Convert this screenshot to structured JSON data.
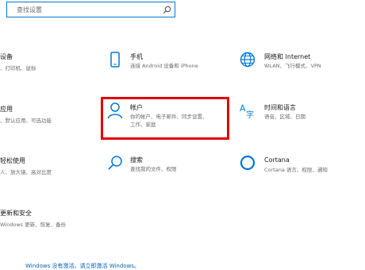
{
  "search": {
    "placeholder": "查找设置"
  },
  "left_column": [
    {
      "title": "设备",
      "desc": "、打印机、鼠标"
    },
    {
      "title": "应用",
      "desc": "、默认应用、可选功能"
    },
    {
      "title": "轻松使用",
      "desc": "人、放大镜、高对比度"
    },
    {
      "title": "更新和安全",
      "desc": "Windows 更新、恢复、备份"
    }
  ],
  "tiles": {
    "phone": {
      "title": "手机",
      "desc": "连接 Android 设备和 iPhone"
    },
    "network": {
      "title": "网络和 Internet",
      "desc": "WLAN、飞行模式、VPN"
    },
    "account": {
      "title": "帐户",
      "desc_line1": "你的帐户、电子邮件、同步设置、",
      "desc_line2": "工作、家庭"
    },
    "time": {
      "title": "时间和语言",
      "desc": "语音、区域、日期"
    },
    "search": {
      "title": "搜索",
      "desc": "查找我的文件、权限"
    },
    "cortana": {
      "title": "Cortana",
      "desc": "Cortana 语言、权限、通知"
    }
  },
  "activation_notice": "Windows 没有激活。请立即激活 Windows。",
  "colors": {
    "accent": "#0078d4",
    "highlight": "#e00000"
  }
}
